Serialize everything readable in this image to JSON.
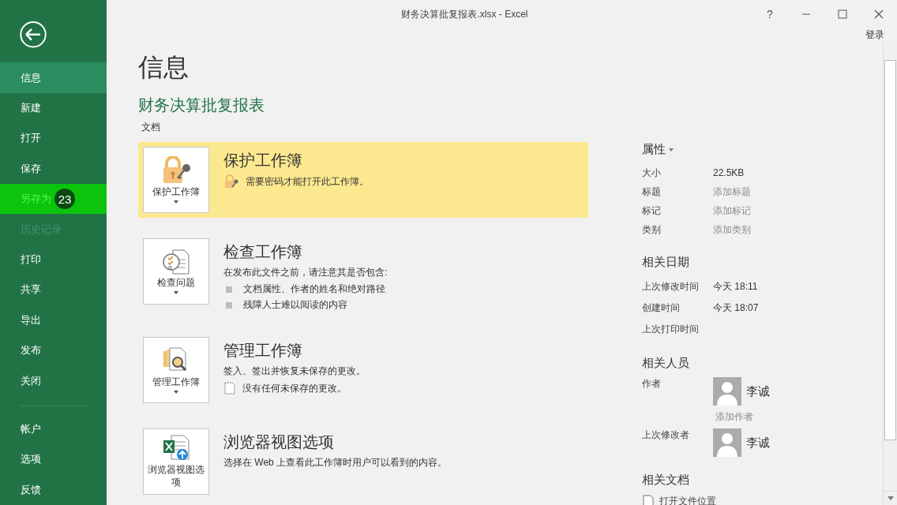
{
  "window": {
    "title": "财务决算批复报表.xlsx - Excel",
    "help": "?",
    "sign_in": "登录"
  },
  "sidebar": {
    "items": [
      {
        "label": "信息",
        "selected": true,
        "highlighted": false,
        "disabled": false
      },
      {
        "label": "新建",
        "selected": false,
        "highlighted": false,
        "disabled": false
      },
      {
        "label": "打开",
        "selected": false,
        "highlighted": false,
        "disabled": false
      },
      {
        "label": "保存",
        "selected": false,
        "highlighted": false,
        "disabled": false
      },
      {
        "label": "另存为",
        "selected": false,
        "highlighted": true,
        "disabled": false,
        "badge": "23"
      },
      {
        "label": "历史记录",
        "selected": false,
        "highlighted": false,
        "disabled": true
      },
      {
        "label": "打印",
        "selected": false,
        "highlighted": false,
        "disabled": false
      },
      {
        "label": "共享",
        "selected": false,
        "highlighted": false,
        "disabled": false
      },
      {
        "label": "导出",
        "selected": false,
        "highlighted": false,
        "disabled": false
      },
      {
        "label": "发布",
        "selected": false,
        "highlighted": false,
        "disabled": false
      },
      {
        "label": "关闭",
        "selected": false,
        "highlighted": false,
        "disabled": false
      }
    ],
    "footer_items": [
      {
        "label": "帐户",
        "selected": false,
        "highlighted": false,
        "disabled": false
      },
      {
        "label": "选项",
        "selected": false,
        "highlighted": false,
        "disabled": false
      },
      {
        "label": "反馈",
        "selected": false,
        "highlighted": false,
        "disabled": false
      }
    ]
  },
  "page": {
    "heading": "信息",
    "doc_title": "财务决算批复报表",
    "doc_location": "文档"
  },
  "sections": [
    {
      "kind": "lock",
      "button_label": "保护工作簿",
      "dropdown": true,
      "highlighted": true,
      "title": "保护工作簿",
      "notes": [
        {
          "kind": "lock",
          "text": "需要密码才能打开此工作簿。"
        }
      ]
    },
    {
      "kind": "inspect",
      "button_label": "检查问题",
      "dropdown": true,
      "highlighted": false,
      "title": "检查工作簿",
      "description": "在发布此文件之前，请注意其是否包含:",
      "notes": [
        {
          "kind": "bullet",
          "text": "文档属性、作者的姓名和绝对路径"
        },
        {
          "kind": "bullet",
          "text": "残障人士难以阅读的内容"
        }
      ]
    },
    {
      "kind": "manage",
      "button_label": "管理工作簿",
      "dropdown": true,
      "highlighted": false,
      "title": "管理工作簿",
      "description": "签入、签出并恢复未保存的更改。",
      "notes": [
        {
          "kind": "page",
          "text": "没有任何未保存的更改。"
        }
      ]
    },
    {
      "kind": "browser",
      "button_label": "浏览器视图选项",
      "dropdown": false,
      "highlighted": false,
      "title": "浏览器视图选项",
      "description": "选择在 Web 上查看此工作簿时用户可以看到的内容。"
    }
  ],
  "properties": {
    "heading": "属性",
    "rows": [
      {
        "label": "大小",
        "value": "22.5KB",
        "kind": "value"
      },
      {
        "label": "标题",
        "value": "添加标题",
        "kind": "placeholder"
      },
      {
        "label": "标记",
        "value": "添加标记",
        "kind": "placeholder"
      },
      {
        "label": "类别",
        "value": "添加类别",
        "kind": "placeholder"
      }
    ]
  },
  "dates": {
    "heading": "相关日期",
    "rows": [
      {
        "label": "上次修改时间",
        "value": "今天 18:11"
      },
      {
        "label": "创建时间",
        "value": "今天 18:07"
      },
      {
        "label": "上次打印时间"
      }
    ]
  },
  "people": {
    "heading": "相关人员",
    "rows": [
      {
        "label": "作者",
        "name": "李诚",
        "add_link": "添加作者"
      },
      {
        "label": "上次修改者",
        "name": "李诚"
      }
    ]
  },
  "related_docs": {
    "heading": "相关文档",
    "links": [
      {
        "text": "打开文件位置"
      }
    ]
  }
}
